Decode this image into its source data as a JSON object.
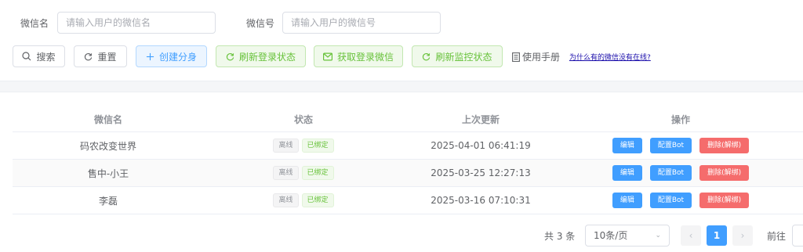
{
  "filters": {
    "wechat_name_label": "微信名",
    "wechat_name_placeholder": "请输入用户的微信名",
    "wechat_id_label": "微信号",
    "wechat_id_placeholder": "请输入用户的微信号"
  },
  "toolbar": {
    "search": "搜索",
    "reset": "重置",
    "create_clone": "创建分身",
    "refresh_login": "刷新登录状态",
    "get_login_wechat": "获取登录微信",
    "refresh_monitor": "刷新监控状态",
    "manual": "使用手册",
    "faq_link": "为什么有的微信没有在线?"
  },
  "table": {
    "headers": [
      "微信名",
      "状态",
      "上次更新",
      "操作"
    ],
    "rows": [
      {
        "name": "码农改变世界",
        "status_online": "离线",
        "status_bind": "已绑定",
        "updated": "2025-04-01 06:41:19"
      },
      {
        "name": "售中-小王",
        "status_online": "离线",
        "status_bind": "已绑定",
        "updated": "2025-03-25 12:27:13"
      },
      {
        "name": "李磊",
        "status_online": "离线",
        "status_bind": "已绑定",
        "updated": "2025-03-16 07:10:31"
      }
    ],
    "actions": {
      "edit": "编辑",
      "config_bot": "配置Bot",
      "delete": "删除(解绑)"
    }
  },
  "pagination": {
    "total": "共 3 条",
    "page_size": "10条/页",
    "current_page": "1",
    "prev": "‹",
    "next": "›",
    "goto_label": "前往"
  },
  "colors": {
    "primary": "#409eff",
    "success": "#67c23a",
    "danger": "#f56c6c"
  }
}
